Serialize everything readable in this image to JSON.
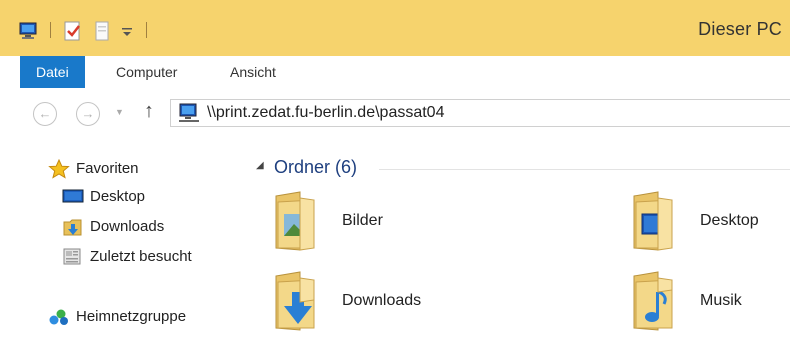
{
  "window": {
    "title": "Dieser PC",
    "accent_color": "#f6d36d",
    "quick_access": [
      "computer-icon",
      "properties-icon",
      "new-folder-icon",
      "customize-toolbar-icon"
    ]
  },
  "ribbon": {
    "tabs": [
      {
        "label": "Datei",
        "active": true
      },
      {
        "label": "Computer",
        "active": false
      },
      {
        "label": "Ansicht",
        "active": false
      }
    ]
  },
  "address": {
    "back_glyph": "←",
    "forward_glyph": "→",
    "up_glyph": "↑",
    "path": "\\\\print.zedat.fu-berlin.de\\passat04"
  },
  "nav": {
    "favorites": {
      "label": "Favoriten",
      "items": [
        {
          "label": "Desktop",
          "icon": "desktop-icon"
        },
        {
          "label": "Downloads",
          "icon": "downloads-icon"
        },
        {
          "label": "Zuletzt besucht",
          "icon": "recent-places-icon"
        }
      ]
    },
    "homegroup": {
      "label": "Heimnetzgruppe",
      "icon": "homegroup-icon"
    }
  },
  "content": {
    "group_title": "Ordner (6)",
    "folders": [
      {
        "label": "Bilder",
        "icon": "pictures-folder-icon"
      },
      {
        "label": "Desktop",
        "icon": "desktop-folder-icon"
      },
      {
        "label": "Downloads",
        "icon": "downloads-folder-icon"
      },
      {
        "label": "Musik",
        "icon": "music-folder-icon"
      }
    ]
  }
}
